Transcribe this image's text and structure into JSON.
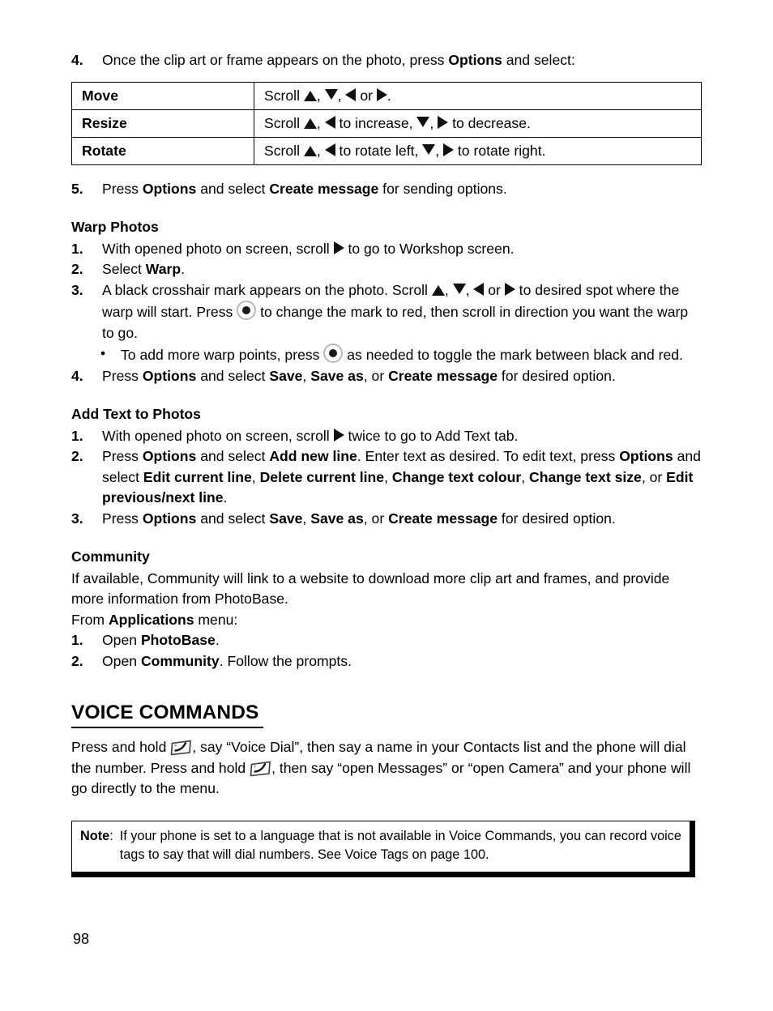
{
  "page": {
    "number": "98"
  },
  "step4": {
    "num": "4.",
    "text_a": "Once the clip art or frame appears on the photo, press ",
    "bold_options": "Options",
    "text_b": " and select:"
  },
  "options_table": {
    "rows": [
      {
        "label": "Move",
        "prefix": "Scroll ",
        "seg1": ", ",
        "seg2": ", ",
        "seg3": " or ",
        "suffix": "."
      },
      {
        "label": "Resize",
        "prefix": "Scroll ",
        "seg1": ", ",
        "seg2": " to increase, ",
        "seg3": ", ",
        "suffix": " to decrease."
      },
      {
        "label": "Rotate",
        "prefix": "Scroll ",
        "seg1": ", ",
        "seg2": " to rotate left, ",
        "seg3": ", ",
        "suffix": " to rotate right."
      }
    ]
  },
  "step5": {
    "num": "5.",
    "text_a": "Press ",
    "bold_options": "Options",
    "text_b": " and select ",
    "bold_create": "Create message",
    "text_c": " for sending options."
  },
  "warp_photos": {
    "heading": "Warp Photos",
    "items": [
      {
        "num": "1.",
        "text_a": "With opened photo on screen, scroll ",
        "text_b": " to go to Workshop screen."
      },
      {
        "num": "2.",
        "text_a": "Select ",
        "bold": "Warp",
        "text_b": "."
      },
      {
        "num": "3.",
        "text_a": "A black crosshair mark appears on the photo. Scroll ",
        "seg1": ", ",
        "seg2": ", ",
        "seg3": " or ",
        "text_b": " to desired spot where the warp will start. Press ",
        "text_c": " to change the mark to red, then scroll in direction you want the warp to go."
      }
    ],
    "bullet": {
      "marker": "•",
      "text_a": "To add more warp points, press ",
      "text_b": " as needed to toggle the mark between black and red."
    },
    "item4": {
      "num": "4.",
      "text_a": "Press ",
      "bold_options": "Options",
      "text_b": " and select ",
      "bold_save": "Save",
      "text_c": ", ",
      "bold_saveas": "Save as",
      "text_d": ", or ",
      "bold_create": "Create message",
      "text_e": " for desired option."
    }
  },
  "add_text": {
    "heading": "Add Text to Photos",
    "item1": {
      "num": "1.",
      "text_a": "With opened photo on screen, scroll ",
      "text_b": " twice to go to Add Text tab."
    },
    "item2": {
      "num": "2.",
      "text_a": "Press ",
      "bold_options": "Options",
      "text_b": " and select ",
      "bold_addnew": "Add new line",
      "text_c": ". Enter text as desired. To edit text, press ",
      "bold_options2": "Options",
      "text_d": " and select ",
      "bold_editcur": "Edit current line",
      "text_e": ", ",
      "bold_delcur": "Delete current line",
      "text_f": ", ",
      "bold_changecol": "Change text colour",
      "text_g": ", ",
      "bold_changesize": "Change text size",
      "text_h": ", or ",
      "bold_editprev": "Edit previous/next line",
      "text_i": "."
    },
    "item3": {
      "num": "3.",
      "text_a": "Press ",
      "bold_options": "Options",
      "text_b": " and select ",
      "bold_save": "Save",
      "text_c": ", ",
      "bold_saveas": "Save as",
      "text_d": ", or ",
      "bold_create": "Create message",
      "text_e": " for desired option."
    }
  },
  "community": {
    "heading": "Community",
    "para1": "If available, Community will link to a website to download more clip art and frames, and provide more information from PhotoBase.",
    "para2_a": "From ",
    "para2_bold": "Applications",
    "para2_b": " menu:",
    "item1": {
      "num": "1.",
      "text_a": "Open ",
      "bold": "PhotoBase",
      "text_b": "."
    },
    "item2": {
      "num": "2.",
      "text_a": "Open ",
      "bold": "Community",
      "text_b": ". Follow the prompts."
    }
  },
  "voice_commands": {
    "heading": "VOICE COMMANDS",
    "body_a": "Press and hold ",
    "body_b": ", say “Voice Dial”, then say a name in your Contacts list and the phone will dial the number. Press and hold ",
    "body_c": ", then say “open Messages” or “open Camera” and your phone will go directly to the menu."
  },
  "note": {
    "label_bold": "Note",
    "label_colon": ":",
    "text": "If your phone is set to a language that is not available in Voice Commands, you can record voice tags to say that will dial numbers. See Voice Tags on page 100."
  },
  "icons": {
    "up": "triangle-up-icon",
    "down": "triangle-down-icon",
    "left": "triangle-left-icon",
    "right": "triangle-right-icon",
    "select": "center-select-button-icon",
    "send": "send-key-icon"
  },
  "colors": {
    "text": "#000000",
    "background": "#ffffff",
    "arrow": "#111111",
    "rule": "#000000"
  }
}
